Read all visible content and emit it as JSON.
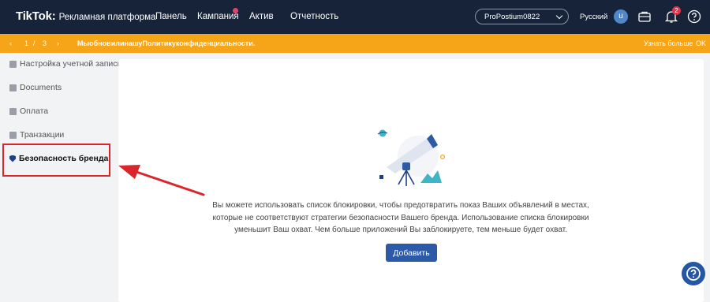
{
  "topnav": {
    "logo_main": "TikTok",
    "logo_colon": ":",
    "logo_sub": "Рекламная платформа",
    "items": [
      {
        "label": "Панель"
      },
      {
        "label": "Кампания"
      },
      {
        "label": "Актив"
      },
      {
        "label": "Отчетность"
      }
    ],
    "account_name": "ProPostium0822",
    "language": "Русский",
    "avatar_letter": "u",
    "notification_count": "2",
    "icons": [
      "briefcase-icon",
      "bell-icon",
      "help-icon"
    ]
  },
  "banner": {
    "prev": "‹",
    "page_current": "1",
    "page_sep": "/",
    "page_total": "3",
    "next": "›",
    "message": "МыобновилинашуПолитикуконфиденциальности.",
    "learn_more": "Узнать больше",
    "ok": "OK",
    "color": "#f6a418"
  },
  "sidebar": {
    "items": [
      {
        "label": "Настройка учетной записи",
        "icon": "settings-icon"
      },
      {
        "label": "Documents",
        "icon": "document-icon"
      },
      {
        "label": "Оплата",
        "icon": "wallet-icon"
      },
      {
        "label": "Транзакции",
        "icon": "transactions-icon"
      },
      {
        "label": "Безопасность бренда",
        "icon": "shield-icon",
        "active": true
      }
    ]
  },
  "main": {
    "description": "Вы можете использовать список блокировки, чтобы предотвратить показ Ваших объявлений в местах, которые не соответствуют стратегии безопасности Вашего бренда. Использование списка блокировки уменьшит Ваш охват. Чем больше приложений Вы заблокируете, тем меньше будет охват.",
    "add_button": "Добавить",
    "accent": "#2b5aa8"
  },
  "annotation_color": "#d8262b"
}
